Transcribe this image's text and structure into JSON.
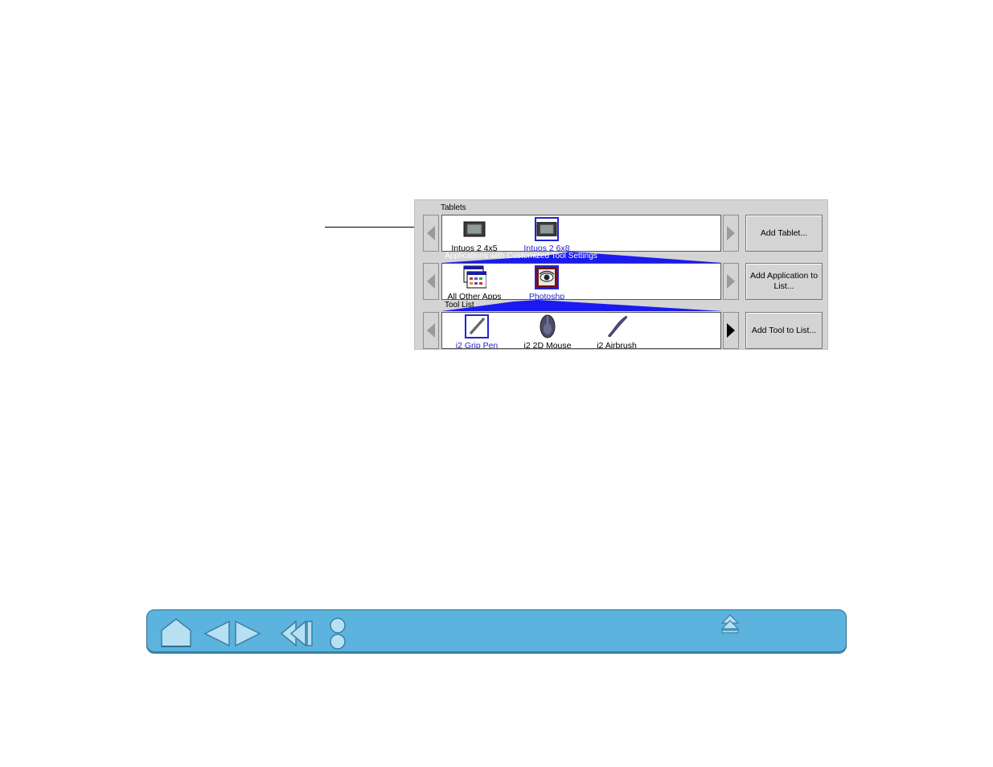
{
  "tablets": {
    "label": "Tablets",
    "items": [
      {
        "label": "Intuos 2 4x5",
        "icon": "tablet-icon",
        "selected": false
      },
      {
        "label": "Intuos 2 6x8",
        "icon": "tablet-icon",
        "selected": true
      }
    ],
    "button": "Add Tablet..."
  },
  "applications": {
    "label": "Applications with Customized Tool Settings",
    "items": [
      {
        "label": "All Other Apps",
        "icon": "all-apps-icon",
        "selected": false
      },
      {
        "label": "Photoshp",
        "icon": "photoshop-icon",
        "selected": true
      }
    ],
    "button": "Add Application to List..."
  },
  "tools": {
    "label": "Tool List",
    "items": [
      {
        "label": "i2 Grip Pen",
        "icon": "pen-icon",
        "selected": true
      },
      {
        "label": "i2 2D Mouse",
        "icon": "mouse-icon",
        "selected": false
      },
      {
        "label": "i2 Airbrush",
        "icon": "airbrush-icon",
        "selected": false
      }
    ],
    "button": "Add Tool to List..."
  },
  "colors": {
    "selection": "#2323d6",
    "panel": "#d4d4d4",
    "navbar": "#5cb3dd"
  },
  "navigation": {
    "icons": [
      "home-icon",
      "previous-page-icon",
      "next-page-icon",
      "back-icon",
      "toggle-icon",
      "eject-icon"
    ]
  }
}
